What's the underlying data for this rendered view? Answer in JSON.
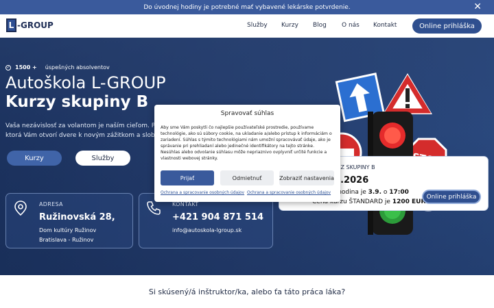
{
  "notice": {
    "text": "Do úvodnej hodiny je potrebné mať vybavené lekárske potvrdenie."
  },
  "header": {
    "logo_mark": "L",
    "logo_text": "-GROUP",
    "nav": [
      "Služby",
      "Kurzy",
      "Blog",
      "O nás",
      "Kontakt"
    ],
    "cta": "Online prihláška"
  },
  "hero": {
    "badge_count": "1500 +",
    "badge_text": "úspešných absolventov",
    "title1": "Autoškola L-GROUP",
    "title2": "Kurzy skupiny B",
    "subtitle_line1": "Vaša nezávislosť za volantom je naším cieľom. Po",
    "subtitle_line2": "ktorá Vám otvorí dvere k novým zážitkom a slobo",
    "btn_kurzy": "Kurzy",
    "btn_sluzby": "Služby"
  },
  "cards": {
    "address": {
      "label": "ADRESA",
      "main": "Ružinovská 28,",
      "line1": "Dom kultúry Ružinov",
      "line2": "Bratislava - Ružinov"
    },
    "contact": {
      "label": "KONTAKT",
      "phone": "+421 904 871 514",
      "email": "info@autoskola-lgroup.sk"
    },
    "course": {
      "label": "NOVÝ KURZ SKUPINY B",
      "date": "08.09.2026",
      "l1_a": "Úvodná hodina je ",
      "l1_b": "3.9.",
      "l1_c": " o ",
      "l1_d": "17:00",
      "l2_a": "Cena kurzu ŠTANDARD je ",
      "l2_b": "1200 EUR",
      "button": "Online prihláška"
    }
  },
  "bottom": {
    "title": "Si skúsený/á inštruktor/ka, alebo ťa táto práca láka?"
  },
  "consent": {
    "title": "Spravovať súhlas",
    "body": "Aby sme Vám poskytli čo najlepšie používateľské prostredie, používame technológie, ako sú súbory cookie, na ukladanie a/alebo prístup k informáciám o zariadení. Súhlas s týmito technológiami nám umožní spracovávať údaje, ako je správanie pri prehliadaní alebo jedinečné identifikátory na tejto stránke. Nesúhlas alebo odvolanie súhlasu môže nepriaznivo ovplyvniť určité funkcie a vlastnosti webovej stránky.",
    "accept": "Prijať",
    "reject": "Odmietnuť",
    "preferences": "Zobraziť nastavenia",
    "link1": "Ochrana a spracovanie osobných údajov",
    "link2": "Ochrana a spracovanie osobných údajov"
  },
  "colors": {
    "primary": "#2f4f8f",
    "notice_bg": "#3a5a9c",
    "hero_dark": "#1c3360"
  }
}
